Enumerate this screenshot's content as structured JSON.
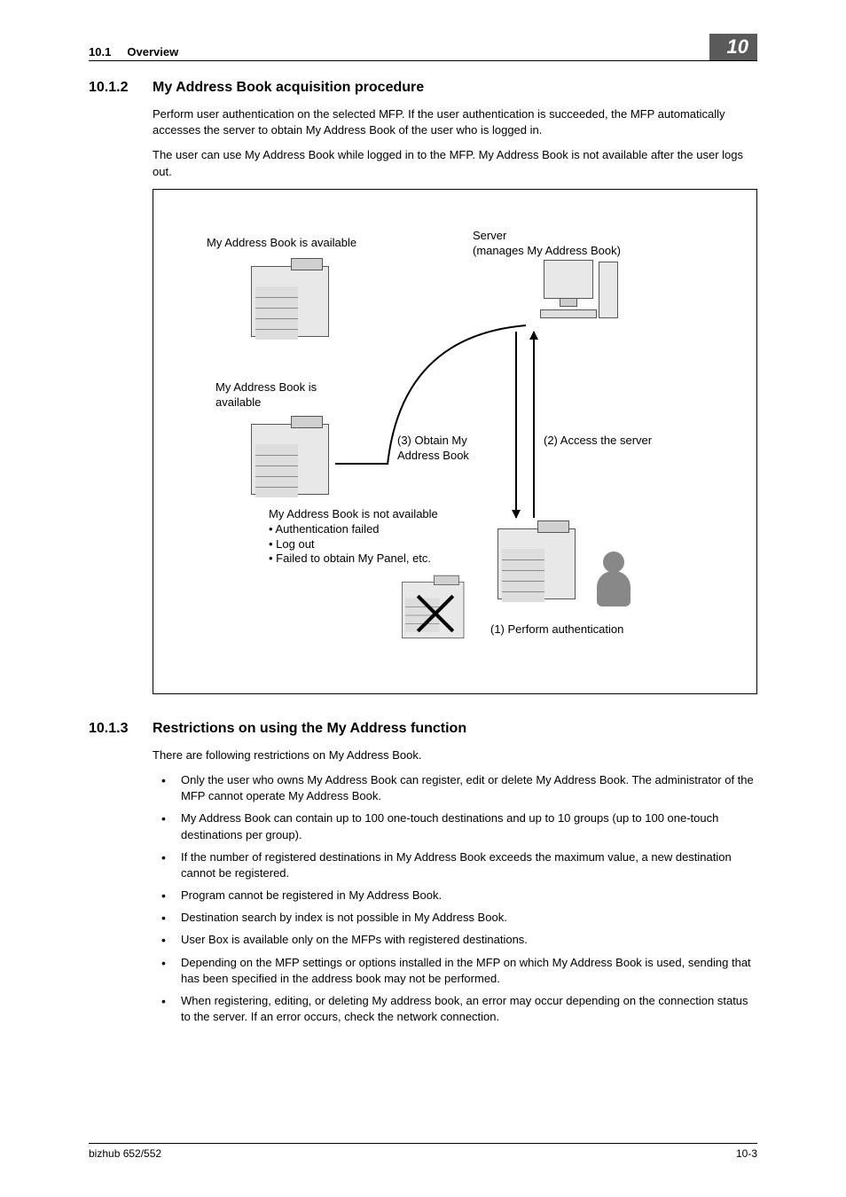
{
  "header": {
    "section_number": "10.1",
    "section_label": "Overview",
    "chapter_number": "10"
  },
  "section_1012": {
    "number": "10.1.2",
    "title": "My Address Book acquisition procedure",
    "para1": "Perform user authentication on the selected MFP. If the user authentication is succeeded, the MFP automatically accesses the server to obtain My Address Book of the user who is logged in.",
    "para2": "The user can use My Address Book while logged in to the MFP. My Address Book is not available after the user logs out."
  },
  "diagram": {
    "label_available_top": "My Address Book is available",
    "label_server": "Server",
    "label_server_sub": "(manages My Address Book)",
    "label_available_mid": "My Address Book is available",
    "label_step3": "(3) Obtain My Address Book",
    "label_step2": "(2) Access the server",
    "label_not_available": "My Address Book is not available",
    "bullet1": "• Authentication failed",
    "bullet2": "• Log out",
    "bullet3": "• Failed to obtain My Panel, etc.",
    "label_step1": "(1) Perform authentication"
  },
  "section_1013": {
    "number": "10.1.3",
    "title": "Restrictions on using the My Address function",
    "intro": "There are following restrictions on My Address Book.",
    "items": [
      "Only the user who owns My Address Book can register, edit or delete My Address Book. The administrator of the MFP cannot operate My Address Book.",
      "My Address Book can contain up to 100 one-touch destinations and up to 10 groups (up to 100 one-touch destinations per group).",
      "If the number of registered destinations in My Address Book exceeds the maximum value, a new destination cannot be registered.",
      "Program cannot be registered in My Address Book.",
      "Destination search by index is not possible in My Address Book.",
      "User Box is available only on the MFPs with registered destinations.",
      "Depending on the MFP settings or options installed in the MFP on which My Address Book is used, sending that has been specified in the address book may not be performed.",
      "When registering, editing, or deleting My address book, an error may occur depending on the connection status to the server. If an error occurs, check the network connection."
    ]
  },
  "footer": {
    "left": "bizhub 652/552",
    "right": "10-3"
  }
}
